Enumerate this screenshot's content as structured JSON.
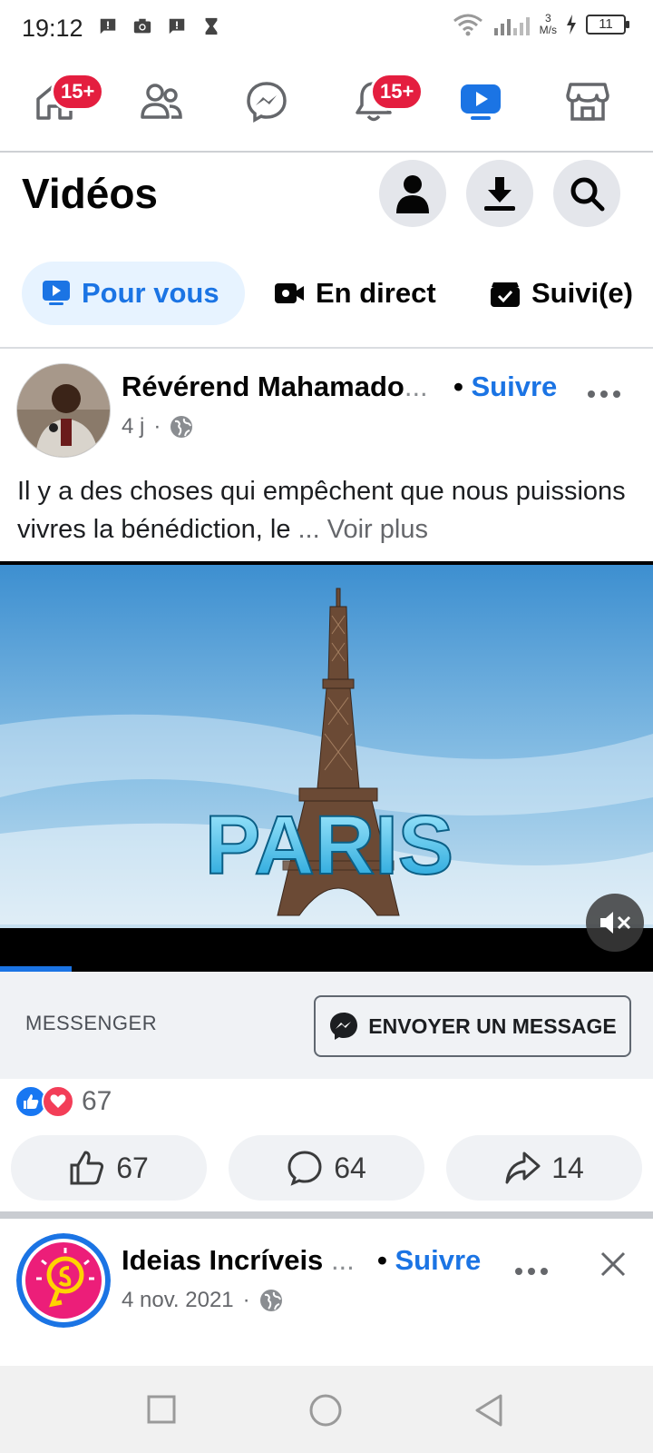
{
  "status_bar": {
    "time": "19:12",
    "net_speed_value": "3",
    "net_speed_unit": "M/s",
    "battery": "11"
  },
  "nav": {
    "home_badge": "15+",
    "notifications_badge": "15+",
    "active_color": "#1b74e4"
  },
  "header": {
    "title": "Vidéos"
  },
  "tabs": [
    {
      "label": "Pour vous",
      "active": true
    },
    {
      "label": "En direct",
      "active": false
    },
    {
      "label": "Suivi(e)",
      "active": false
    }
  ],
  "post1": {
    "author": "Révérend Mahamado",
    "ellipsis": "...",
    "dot": "•",
    "follow": "Suivre",
    "time": "4 j",
    "separator": "·",
    "text": "Il y a des choses qui empêchent que nous puissions vivres la bénédiction, le ",
    "text_ellipsis": "... ",
    "see_more": "Voir plus",
    "video_overlay_text": "PARIS",
    "messenger_label": "MESSENGER",
    "send_message": "ENVOYER UN MESSAGE",
    "reactions_count": "67",
    "likes": "67",
    "comments": "64",
    "shares": "14",
    "video_progress_fraction": 0.11
  },
  "post2": {
    "author": "Ideias Incríveis",
    "ellipsis": "...",
    "dot": "•",
    "follow": "Suivre",
    "time": "4 nov. 2021",
    "separator": "·"
  },
  "colors": {
    "brand_blue": "#1b74e4",
    "badge_red": "#e41e3f"
  }
}
